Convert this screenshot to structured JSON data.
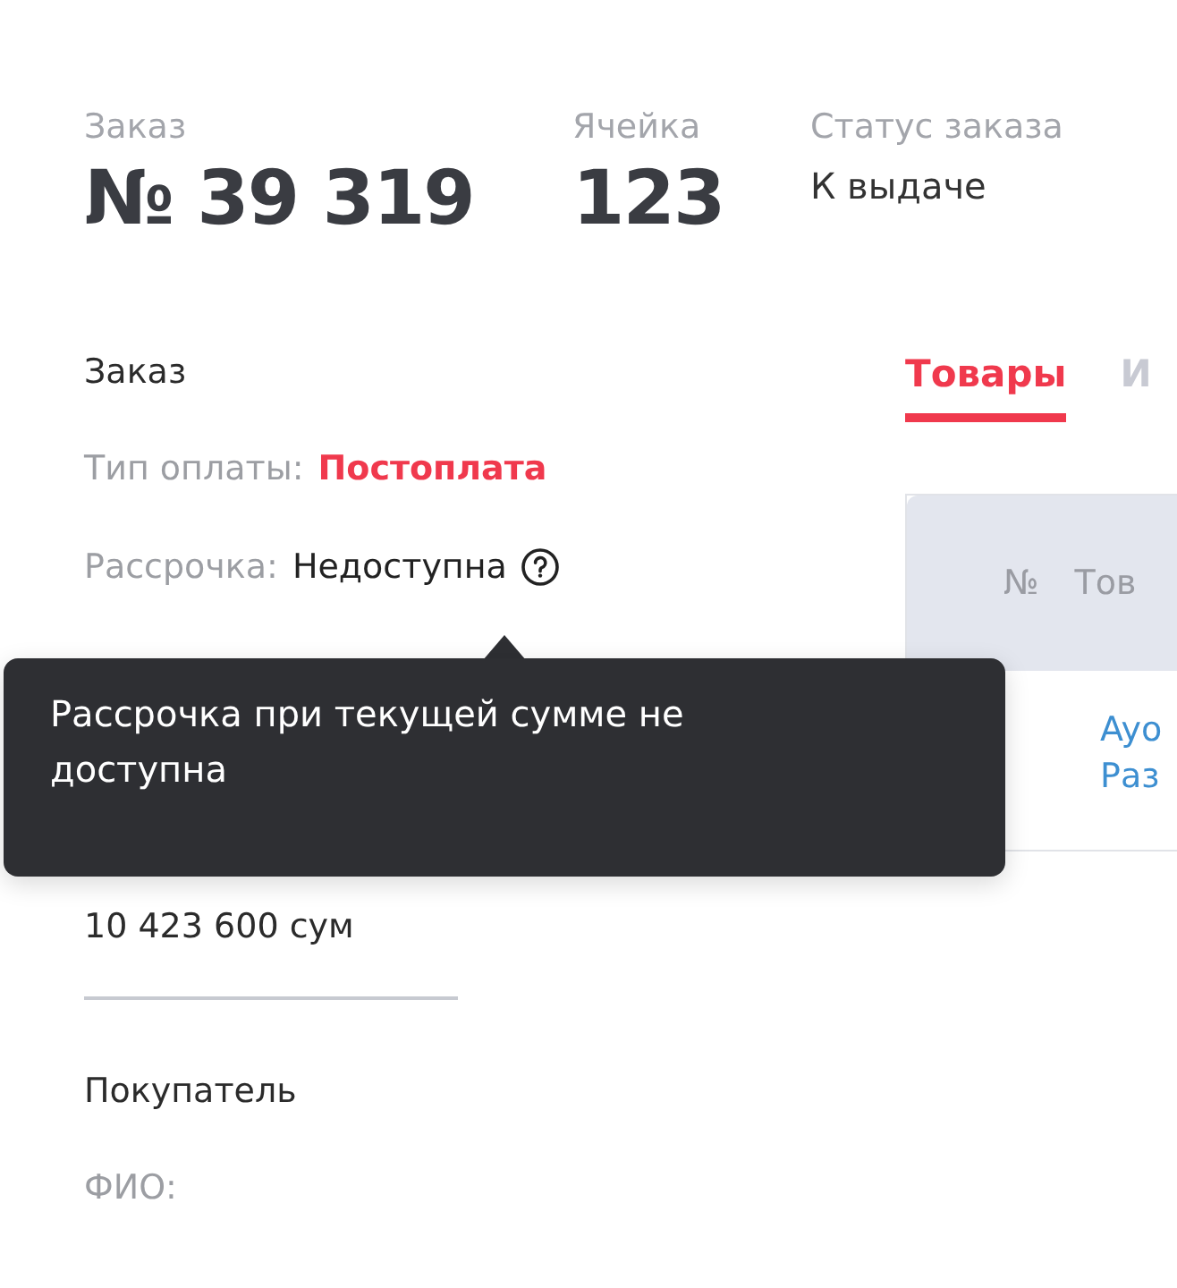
{
  "summary": [
    {
      "label": "Заказ",
      "value": "№ 39 319",
      "kind": "big"
    },
    {
      "label": "Ячейка",
      "value": "123",
      "kind": "big"
    },
    {
      "label": "Статус заказа",
      "value": "К выдаче",
      "kind": "plain"
    }
  ],
  "order": {
    "heading": "Заказ",
    "fields": [
      {
        "label": "Тип оплаты:",
        "value": "Постоплата",
        "kind": "alert"
      },
      {
        "label": "Рассрочка:",
        "value": "Недоступна",
        "kind": "help"
      }
    ],
    "total_value": "10 423 600 сум"
  },
  "tooltip": "Рассрочка при текущей сумме не доступна",
  "buyer": {
    "heading": "Покупатель",
    "fields": [
      {
        "label": "ФИО:"
      }
    ]
  },
  "tabs": [
    {
      "label": "Товары",
      "selected": true
    },
    {
      "label": "И",
      "selected": false
    }
  ],
  "table": {
    "columns": [
      "№",
      "Тов"
    ],
    "rows": [
      {
        "lines": [
          "Ayo",
          "Раз"
        ]
      }
    ]
  }
}
